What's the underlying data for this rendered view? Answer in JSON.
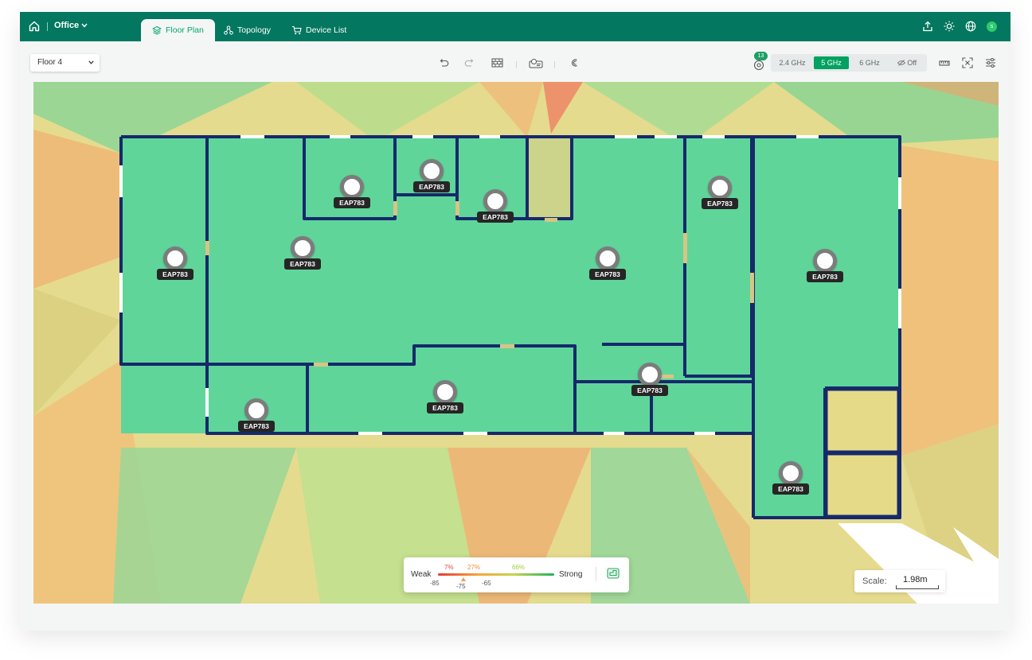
{
  "header": {
    "site_name": "Office",
    "tabs": [
      {
        "label": "Floor Plan",
        "active": true
      },
      {
        "label": "Topology",
        "active": false
      },
      {
        "label": "Device List",
        "active": false
      }
    ],
    "user_initial": "s"
  },
  "toolbar": {
    "floor_select": "Floor 4",
    "device_count": "13",
    "bands": [
      "2.4 GHz",
      "5 GHz",
      "6 GHz",
      "Off"
    ],
    "selected_band": "5 GHz"
  },
  "map": {
    "access_points": [
      {
        "label": "EAP783"
      },
      {
        "label": "EAP783"
      },
      {
        "label": "EAP783"
      },
      {
        "label": "EAP783"
      },
      {
        "label": "EAP783"
      },
      {
        "label": "EAP783"
      },
      {
        "label": "EAP783"
      },
      {
        "label": "EAP783"
      },
      {
        "label": "EAP783"
      },
      {
        "label": "EAP783"
      },
      {
        "label": "EAP783"
      },
      {
        "label": "EAP783"
      }
    ],
    "legend": {
      "weak_label": "Weak",
      "strong_label": "Strong",
      "pct_1": "7%",
      "pct_2": "27%",
      "pct_3": "66%",
      "dbm_1": "-85",
      "dbm_2": "-75",
      "dbm_3": "-65"
    },
    "scale": {
      "label": "Scale:",
      "value": "1.98m"
    }
  },
  "colors": {
    "brand": "#03775f",
    "accent": "#02a260",
    "room_fill": "#5fd59a",
    "wall": "#16296b"
  }
}
